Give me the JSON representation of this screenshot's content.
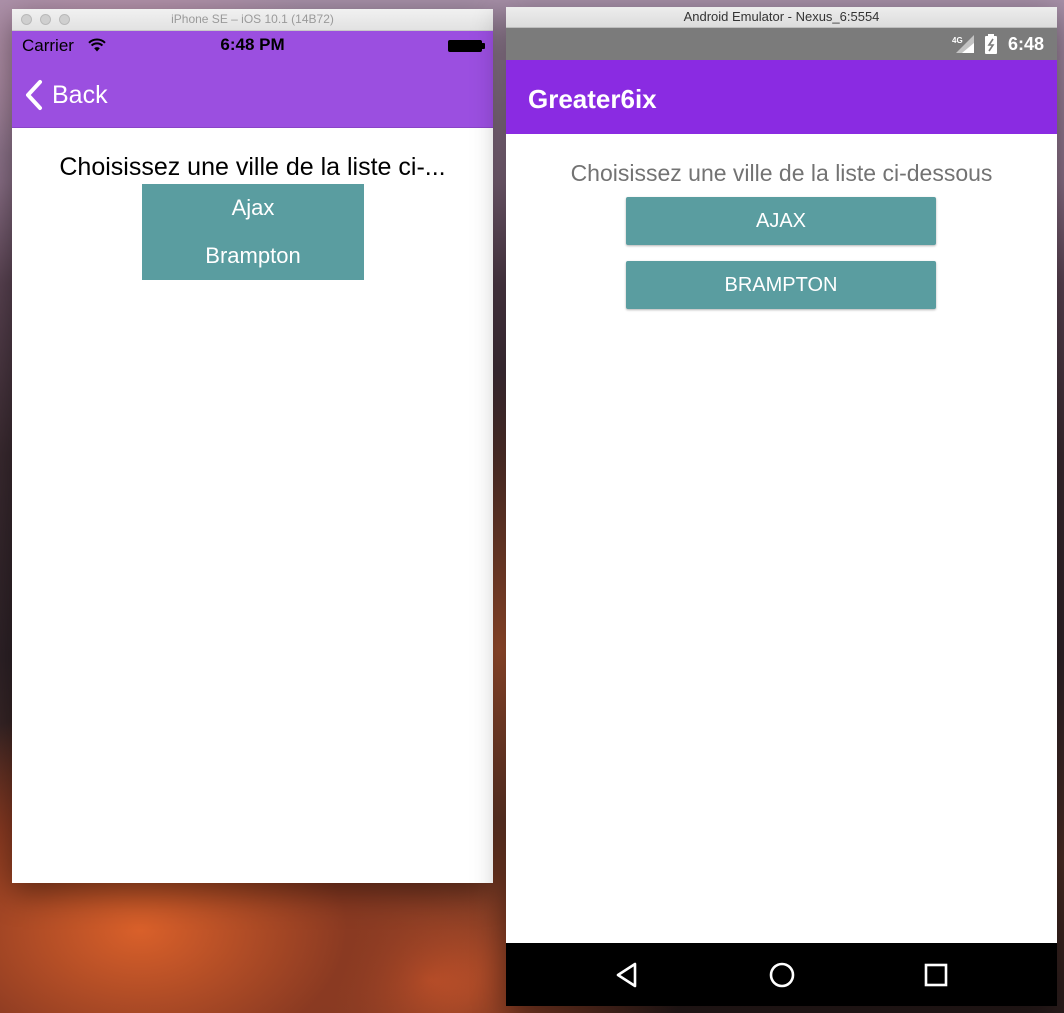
{
  "ios": {
    "window_title": "iPhone SE – iOS 10.1 (14B72)",
    "status": {
      "carrier": "Carrier",
      "time": "6:48 PM"
    },
    "nav": {
      "back_label": "Back"
    },
    "heading": "Choisissez une ville de la liste ci-...",
    "cities": [
      "Ajax",
      "Brampton"
    ],
    "colors": {
      "nav_bg": "#9b4fe0",
      "list_bg": "#5a9da0"
    }
  },
  "android": {
    "window_title": "Android Emulator - Nexus_6:5554",
    "status": {
      "network": "4G",
      "time": "6:48"
    },
    "app_title": "Greater6ix",
    "heading": "Choisissez une ville de la liste ci-dessous",
    "cities": [
      "AJAX",
      "BRAMPTON"
    ],
    "colors": {
      "appbar_bg": "#8a2be2",
      "button_bg": "#5a9da0"
    },
    "icons": [
      "back-triangle-icon",
      "home-circle-icon",
      "recents-square-icon"
    ]
  }
}
